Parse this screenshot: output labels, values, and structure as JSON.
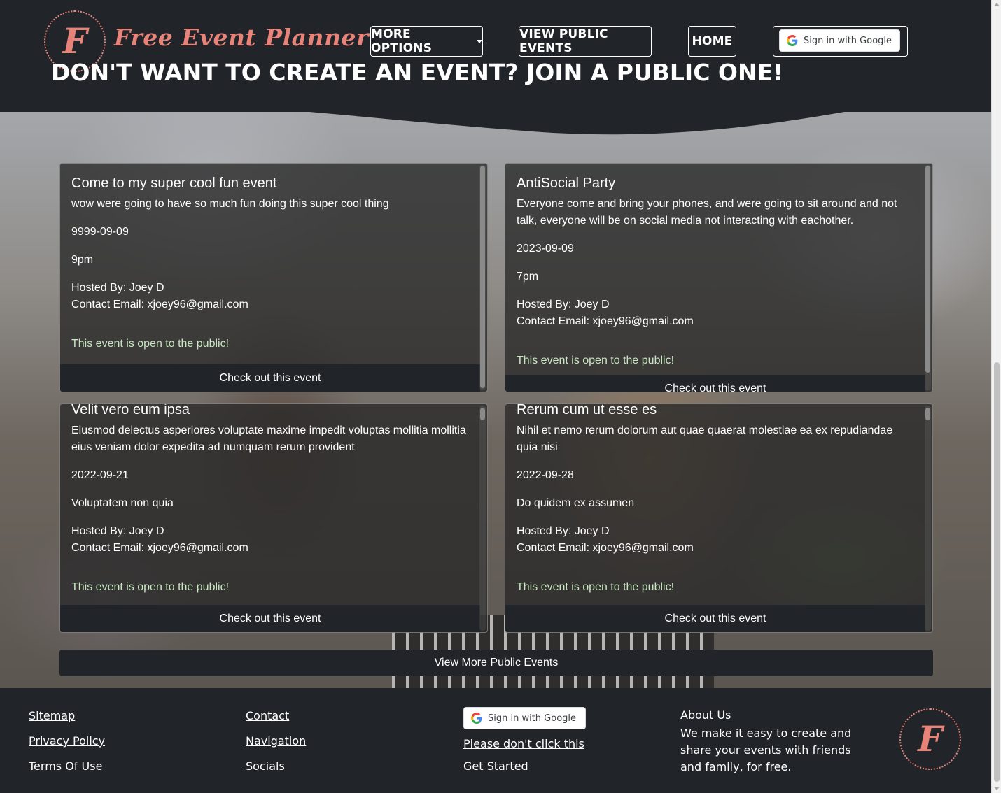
{
  "header": {
    "logo_letter": "F",
    "brand": "Free Event Planner",
    "nav": {
      "more_options": "MORE OPTIONS",
      "view_public_events": "VIEW PUBLIC EVENTS",
      "home": "HOME"
    },
    "google_signin": "Sign in with Google"
  },
  "hero": {
    "headline": "DON'T WANT TO CREATE AN EVENT? JOIN A PUBLIC ONE!",
    "cards": [
      {
        "title": "Come to my super cool fun event",
        "description": "wow were going to have so much fun doing this super cool thing",
        "date": "9999-09-09",
        "time": "9pm",
        "hosted_by": "Hosted By: Joey D",
        "contact": "Contact Email: xjoey96@gmail.com",
        "public_note": "This event is open to the public!",
        "button": "Check out this event"
      },
      {
        "title": "AntiSocial Party",
        "description": "Everyone come and bring your phones, and were going to sit around and not talk, everyone will be on social media not interacting with eachother.",
        "date": "2023-09-09",
        "time": "7pm",
        "hosted_by": "Hosted By: Joey D",
        "contact": "Contact Email: xjoey96@gmail.com",
        "public_note": "This event is open to the public!",
        "button": "Check out this event"
      },
      {
        "title": "Velit vero eum ipsa",
        "description": "Eiusmod delectus asperiores voluptate maxime impedit voluptas mollitia mollitia eius veniam dolor expedita ad numquam rerum provident",
        "date": "2022-09-21",
        "time": "Voluptatem non quia",
        "hosted_by": "Hosted By: Joey D",
        "contact": "Contact Email: xjoey96@gmail.com",
        "public_note": "This event is open to the public!",
        "button": "Check out this event"
      },
      {
        "title": "Rerum cum ut esse es",
        "description": "Nihil et nemo rerum dolorum aut quae quaerat molestiae ea ex repudiandae quia nisi",
        "date": "2022-09-28",
        "time": "Do quidem ex assumen",
        "hosted_by": "Hosted By: Joey D",
        "contact": "Contact Email: xjoey96@gmail.com",
        "public_note": "This event is open to the public!",
        "button": "Check out this event"
      }
    ],
    "more_button": "View More Public Events"
  },
  "footer": {
    "col1": [
      "Sitemap",
      "Privacy Policy",
      "Terms Of Use"
    ],
    "col2": [
      "Contact",
      "Navigation",
      "Socials"
    ],
    "google_signin": "Sign in with Google",
    "col3": [
      "Please don't click this",
      "Get Started"
    ],
    "about_title": "About Us",
    "about_text": "We make it easy to create and share your events with friends and family, for free.",
    "logo_letter": "F"
  },
  "colors": {
    "brand": "#e8837a",
    "background": "#212529",
    "public_note": "#c8e6c1"
  },
  "icons": [
    "google-g-icon",
    "caret-down-icon"
  ]
}
